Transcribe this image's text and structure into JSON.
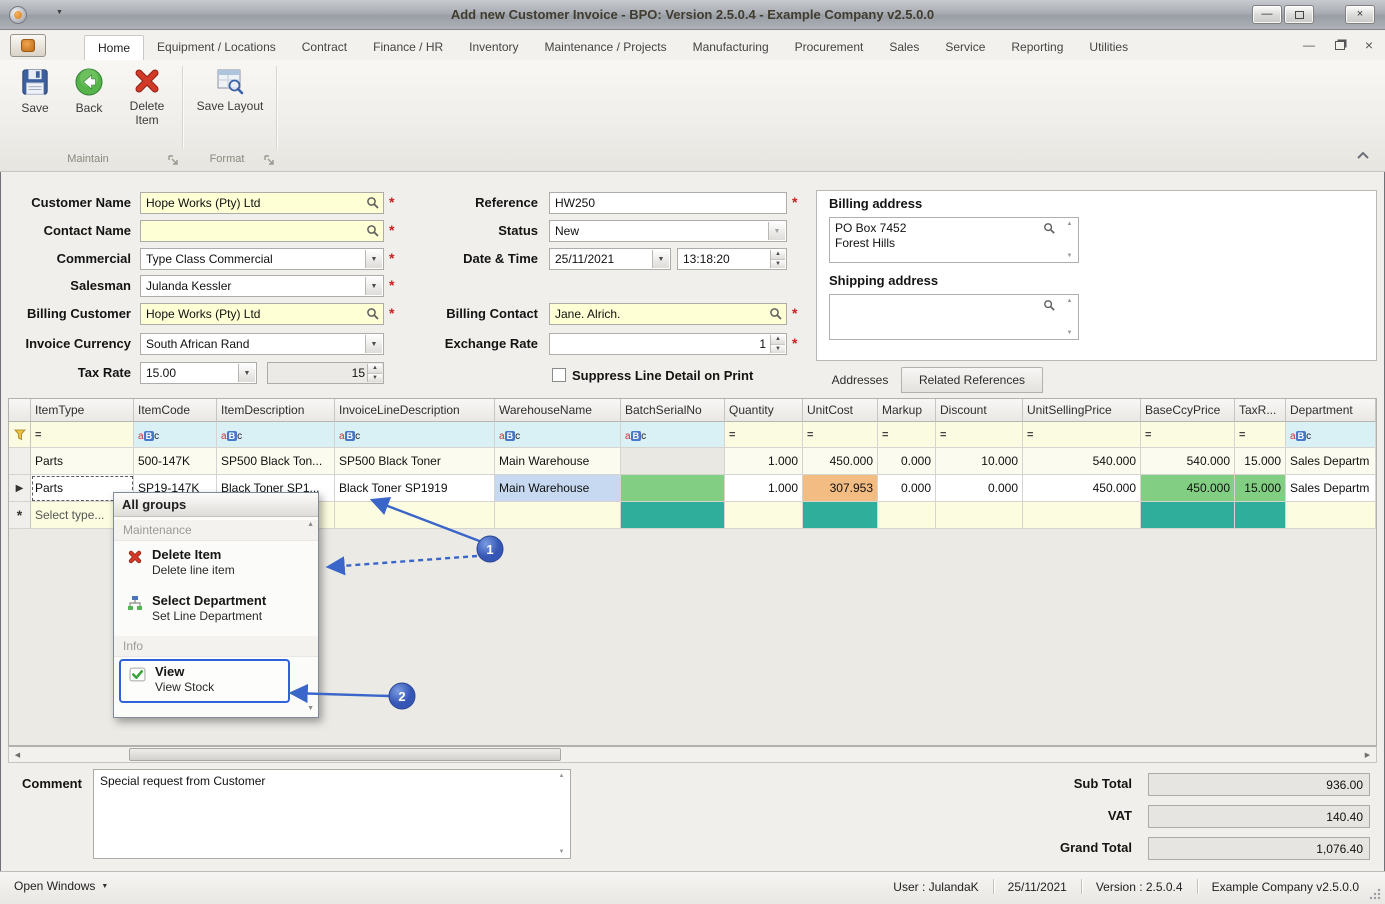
{
  "colors": {
    "accent-blue": "#3a66c9",
    "required-red": "#cc1f1f",
    "field-yellow": "#feffd4",
    "cell-green": "#82ce82",
    "cell-teal": "#2fae9b",
    "cell-orange": "#f2bc82",
    "cell-blue": "#c6d9f0",
    "cell-gray": "#e9e8e3",
    "filter-cyan": "#d9f0f5",
    "row-cream": "#fbfbef",
    "new-row-cream": "#fcfce0"
  },
  "window": {
    "title": "Add new Customer Invoice - BPO: Version 2.5.0.4 - Example Company v2.5.0.0"
  },
  "icons": {
    "dropdown": "▼",
    "spin_up": "▲",
    "spin_down": "▼",
    "scroll_up": "▲",
    "scroll_down": "▼",
    "scroll_left": "◀",
    "scroll_right": "▶",
    "current_row": "▶",
    "new_row": "*",
    "minimize": "—",
    "close": "×",
    "equals_filter": "=",
    "abc_a": "a",
    "abc_b": "B",
    "abc_c": "c",
    "caret_down": "▼"
  },
  "ribbon": {
    "tabs": [
      "Home",
      "Equipment / Locations",
      "Contract",
      "Finance / HR",
      "Inventory",
      "Maintenance / Projects",
      "Manufacturing",
      "Procurement",
      "Sales",
      "Service",
      "Reporting",
      "Utilities"
    ],
    "buttons": [
      {
        "label": "Save"
      },
      {
        "label": "Back"
      },
      {
        "label": "Delete Item"
      },
      {
        "label": "Save Layout"
      }
    ],
    "groups": [
      {
        "label": "Maintain"
      },
      {
        "label": "Format"
      }
    ]
  },
  "form": {
    "required_marker": "*",
    "customer_name": {
      "label": "Customer Name",
      "value": "Hope Works (Pty) Ltd"
    },
    "contact_name": {
      "label": "Contact Name",
      "value": ""
    },
    "commercial": {
      "label": "Commercial",
      "value": "Type Class Commercial"
    },
    "salesman": {
      "label": "Salesman",
      "value": "Julanda Kessler"
    },
    "billing_customer": {
      "label": "Billing Customer",
      "value": "Hope Works (Pty) Ltd"
    },
    "invoice_currency": {
      "label": "Invoice Currency",
      "value": "South African Rand"
    },
    "tax_rate": {
      "label": "Tax Rate",
      "value": "15.00",
      "value2": "15"
    },
    "reference": {
      "label": "Reference",
      "value": "HW250"
    },
    "status": {
      "label": "Status",
      "value": "New"
    },
    "date_time": {
      "label": "Date & Time",
      "date": "25/11/2021",
      "time": "13:18:20"
    },
    "billing_contact": {
      "label": "Billing Contact",
      "value": "Jane. Alrich."
    },
    "exchange_rate": {
      "label": "Exchange Rate",
      "value": "1"
    },
    "suppress_label": "Suppress Line Detail on Print"
  },
  "addresses": {
    "billing_label": "Billing address",
    "billing_value": "PO Box 7452\nForest Hills",
    "shipping_label": "Shipping address",
    "shipping_value": "",
    "tabs": [
      "Addresses",
      "Related References"
    ]
  },
  "grid": {
    "columns": [
      "ItemType",
      "ItemCode",
      "ItemDescription",
      "InvoiceLineDescription",
      "WarehouseName",
      "BatchSerialNo",
      "Quantity",
      "UnitCost",
      "Markup",
      "Discount",
      "UnitSellingPrice",
      "BaseCcyPrice",
      "TaxR...",
      "Department"
    ],
    "rows": [
      {
        "cells": [
          "Parts",
          "500-147K",
          "SP500 Black Ton...",
          "SP500 Black Toner",
          "Main Warehouse",
          "",
          "1.000",
          "450.000",
          "0.000",
          "10.000",
          "540.000",
          "540.000",
          "15.000",
          "Sales Departm"
        ]
      },
      {
        "cells": [
          "Parts",
          "SP19-147K",
          "Black Toner SP1...",
          "Black Toner SP1919",
          "Main Warehouse",
          "",
          "1.000",
          "307.953",
          "0.000",
          "0.000",
          "450.000",
          "450.000",
          "15.000",
          "Sales Departm"
        ]
      },
      {
        "cells": [
          "Select type...",
          "",
          "",
          "",
          "",
          "",
          "",
          "",
          "",
          "",
          "",
          "",
          "",
          ""
        ]
      }
    ]
  },
  "context_menu": {
    "header": "All groups",
    "sections": [
      {
        "label": "Maintenance",
        "items": [
          {
            "title": "Delete Item",
            "subtitle": "Delete line item"
          },
          {
            "title": "Select Department",
            "subtitle": "Set Line Department"
          }
        ]
      },
      {
        "label": "Info",
        "items": [
          {
            "title": "View",
            "subtitle": "View Stock"
          }
        ]
      }
    ]
  },
  "callouts": [
    {
      "label": "1"
    },
    {
      "label": "2"
    }
  ],
  "comment": {
    "label": "Comment",
    "value": "Special request from Customer"
  },
  "totals": {
    "sub_total_label": "Sub Total",
    "sub_total": "936.00",
    "vat_label": "VAT",
    "vat": "140.40",
    "grand_total_label": "Grand Total",
    "grand_total": "1,076.40"
  },
  "statusbar": {
    "open_windows": "Open Windows",
    "user": "User : JulandaK",
    "date": "25/11/2021",
    "version": "Version : 2.5.0.4",
    "company": "Example Company v2.5.0.0"
  }
}
